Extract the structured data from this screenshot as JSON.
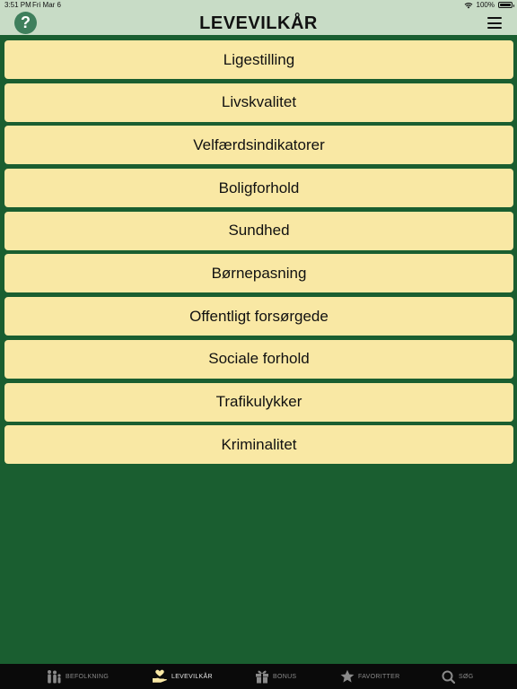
{
  "status_bar": {
    "time": "3:51 PM",
    "date": "Fri Mar 6",
    "battery": "100%",
    "icons": [
      "wifi-icon",
      "battery-icon"
    ]
  },
  "nav": {
    "help_label": "?",
    "title": "LEVEVILKÅR",
    "menu_icon": "hamburger-menu-icon"
  },
  "items": [
    {
      "label": "Ligestilling"
    },
    {
      "label": "Livskvalitet"
    },
    {
      "label": "Velfærdsindikatorer"
    },
    {
      "label": "Boligforhold"
    },
    {
      "label": "Sundhed"
    },
    {
      "label": "Børnepasning"
    },
    {
      "label": "Offentligt forsørgede"
    },
    {
      "label": "Sociale forhold"
    },
    {
      "label": "Trafikulykker"
    },
    {
      "label": "Kriminalitet"
    }
  ],
  "tabs": [
    {
      "label": "BEFOLKNING",
      "icon": "people-icon",
      "active": false
    },
    {
      "label": "LEVEVILKÅR",
      "icon": "hand-heart-icon",
      "active": true
    },
    {
      "label": "BONUS",
      "icon": "gift-icon",
      "active": false
    },
    {
      "label": "FAVORITTER",
      "icon": "star-icon",
      "active": false
    },
    {
      "label": "SØG",
      "icon": "search-icon",
      "active": false
    }
  ],
  "colors": {
    "background": "#1a5e30",
    "header": "#c8dcc6",
    "item": "#f9e8a4",
    "tab_bar": "#0a0a0a",
    "help_button": "#3f7f5c"
  }
}
